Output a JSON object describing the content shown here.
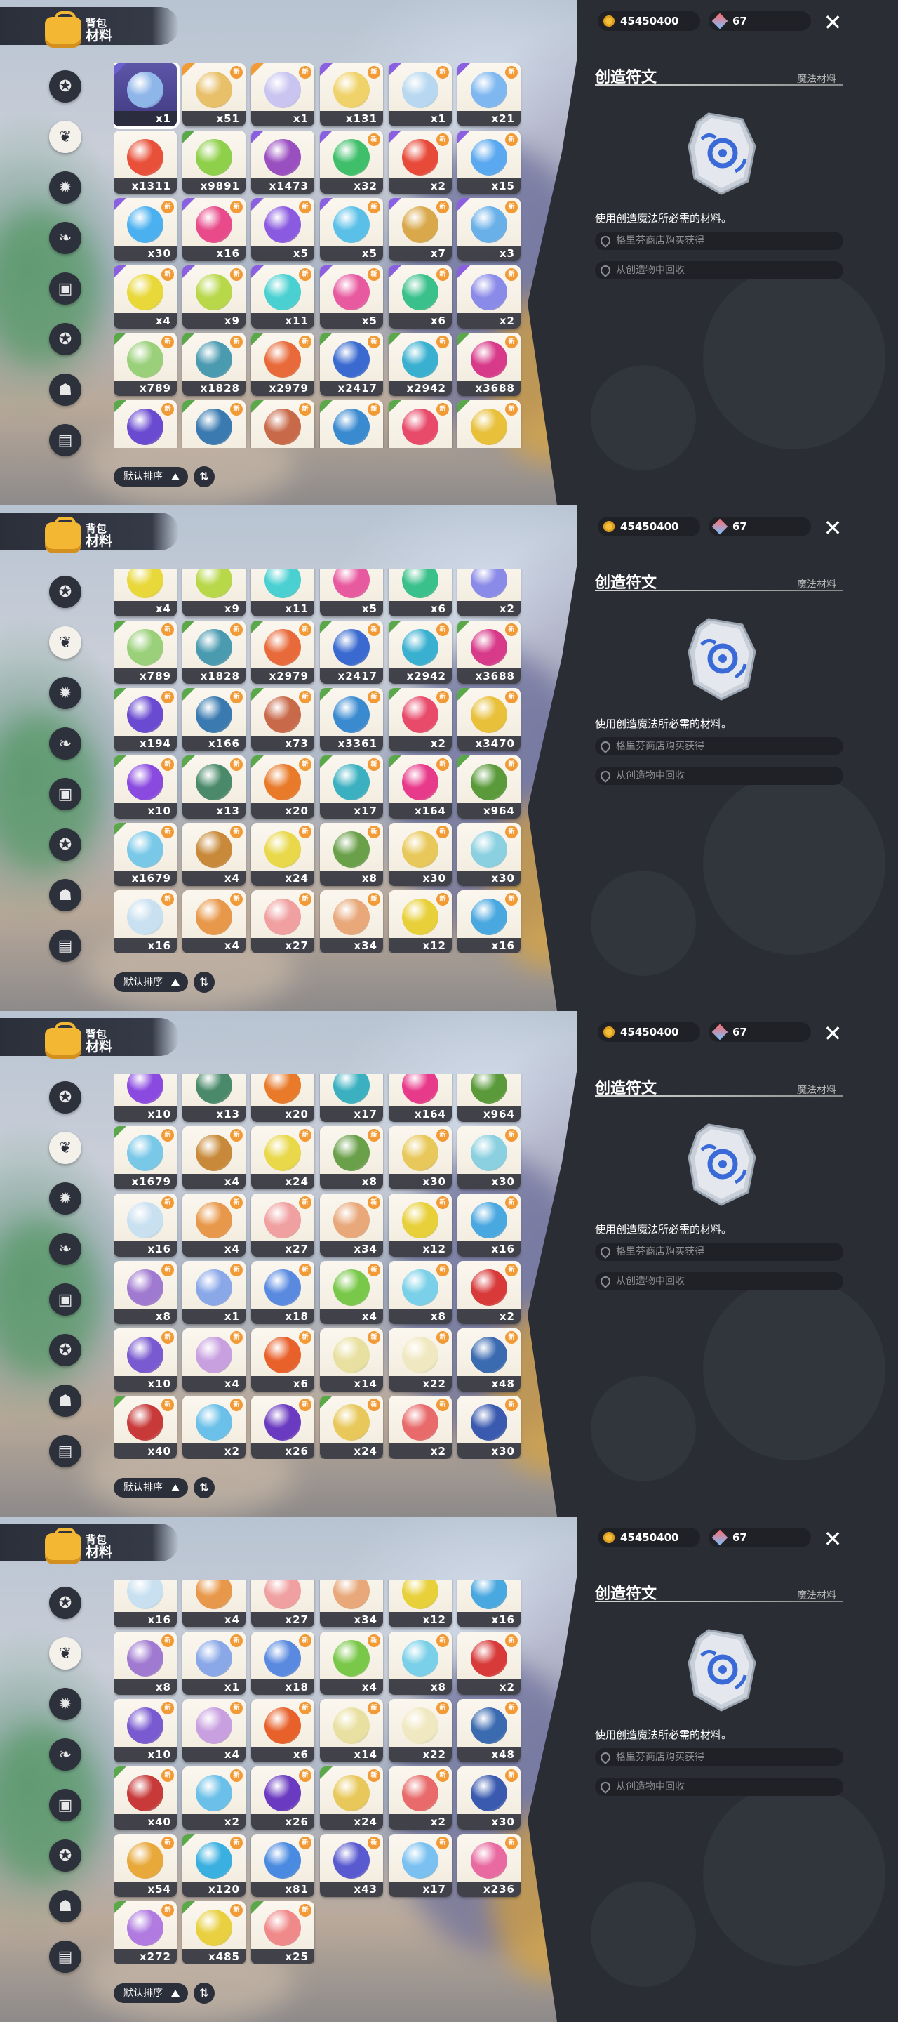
{
  "header": {
    "bag_label": "背包",
    "section_label": "材料"
  },
  "categories": [
    {
      "icon": "circle-star-icon"
    },
    {
      "icon": "leaf-sprout-icon"
    },
    {
      "icon": "star-badge-icon"
    },
    {
      "icon": "plant-icon"
    },
    {
      "icon": "chest-icon"
    },
    {
      "icon": "star-circle-icon"
    },
    {
      "icon": "bell-icon"
    },
    {
      "icon": "crate-icon"
    }
  ],
  "sort": {
    "label": "默认排序"
  },
  "currency": {
    "gold": "45450400",
    "gems": "67"
  },
  "detail": {
    "title": "创造符文",
    "category": "魔法材料",
    "description": "使用创造魔法所必需的材料。",
    "sources": [
      "格里芬商店购买获得",
      "从创造物中回收"
    ]
  },
  "panels": [
    {
      "rows": [
        [
          {
            "q": "x1",
            "c": "#8fb6e8",
            "sel": true,
            "tri": "#6c5fcf",
            "nb": false
          },
          {
            "q": "x51",
            "c": "#e8c06a",
            "tri": "#f29a35",
            "nb": true
          },
          {
            "q": "x1",
            "c": "#c9c4f0",
            "tri": "#f29a35",
            "nb": true
          },
          {
            "q": "x131",
            "c": "#f0d26a",
            "tri": "#8a5fe0",
            "nb": true
          },
          {
            "q": "x1",
            "c": "#b7d8f0",
            "tri": "#8a5fe0",
            "nb": true
          },
          {
            "q": "x21",
            "c": "#7fb8f0",
            "tri": "#8a5fe0",
            "nb": true
          }
        ],
        [
          {
            "q": "x1311",
            "c": "#e8503a",
            "tri": "",
            "nb": false
          },
          {
            "q": "x9891",
            "c": "#8fd04a",
            "tri": "#5aa84a",
            "nb": false
          },
          {
            "q": "x1473",
            "c": "#9a4fc0",
            "tri": "#8a5fe0",
            "nb": false
          },
          {
            "q": "x32",
            "c": "#3fbf6a",
            "tri": "#8a5fe0",
            "nb": true
          },
          {
            "q": "x2",
            "c": "#e84a3a",
            "tri": "#8a5fe0",
            "nb": true
          },
          {
            "q": "x15",
            "c": "#5aa8f0",
            "tri": "#8a5fe0",
            "nb": true
          }
        ],
        [
          {
            "q": "x30",
            "c": "#4ab0f0",
            "tri": "#8a5fe0",
            "nb": true
          },
          {
            "q": "x16",
            "c": "#e84a8a",
            "tri": "#8a5fe0",
            "nb": true
          },
          {
            "q": "x5",
            "c": "#8a5ae0",
            "tri": "#8a5fe0",
            "nb": true
          },
          {
            "q": "x5",
            "c": "#5ac0e8",
            "tri": "#8a5fe0",
            "nb": true
          },
          {
            "q": "x7",
            "c": "#d8a84a",
            "tri": "#8a5fe0",
            "nb": true
          },
          {
            "q": "x3",
            "c": "#6ab0e8",
            "tri": "#8a5fe0",
            "nb": true
          }
        ],
        [
          {
            "q": "x4",
            "c": "#e8d83a",
            "tri": "#8a5fe0",
            "nb": true
          },
          {
            "q": "x9",
            "c": "#b8d84a",
            "tri": "#8a5fe0",
            "nb": true
          },
          {
            "q": "x11",
            "c": "#4ad0d0",
            "tri": "#8a5fe0",
            "nb": true
          },
          {
            "q": "x5",
            "c": "#e85aa0",
            "tri": "#8a5fe0",
            "nb": true
          },
          {
            "q": "x6",
            "c": "#3ac08a",
            "tri": "#8a5fe0",
            "nb": true
          },
          {
            "q": "x2",
            "c": "#8a8ae8",
            "tri": "#8a5fe0",
            "nb": true
          }
        ],
        [
          {
            "q": "x789",
            "c": "#9ad07a",
            "tri": "#5aa84a",
            "nb": true
          },
          {
            "q": "x1828",
            "c": "#4a9ab0",
            "tri": "#5aa84a",
            "nb": true
          },
          {
            "q": "x2979",
            "c": "#e86a3a",
            "tri": "#5aa84a",
            "nb": true
          },
          {
            "q": "x2417",
            "c": "#3a6ad0",
            "tri": "#5aa84a",
            "nb": true
          },
          {
            "q": "x2942",
            "c": "#3ab0d0",
            "tri": "#5aa84a",
            "nb": true
          },
          {
            "q": "x3688",
            "c": "#d83a8a",
            "tri": "#5aa84a",
            "nb": true
          }
        ],
        [
          {
            "q": "x194",
            "c": "#6a4ad0",
            "tri": "#5aa84a",
            "nb": true
          },
          {
            "q": "x166",
            "c": "#3a7ab0",
            "tri": "#5aa84a",
            "nb": true
          },
          {
            "q": "x73",
            "c": "#c86a4a",
            "tri": "#5aa84a",
            "nb": true
          },
          {
            "q": "x3361",
            "c": "#3a8ad0",
            "tri": "#5aa84a",
            "nb": true
          },
          {
            "q": "x2",
            "c": "#e84a6a",
            "tri": "#5aa84a",
            "nb": true
          },
          {
            "q": "x3470",
            "c": "#e8c03a",
            "tri": "#5aa84a",
            "nb": true
          }
        ]
      ]
    },
    {
      "rows": [
        [
          {
            "q": "x4",
            "c": "#e8d83a",
            "tri": "#8a5fe0",
            "nb": true
          },
          {
            "q": "x9",
            "c": "#b8d84a",
            "tri": "#8a5fe0",
            "nb": true
          },
          {
            "q": "x11",
            "c": "#4ad0d0",
            "tri": "#8a5fe0",
            "nb": true
          },
          {
            "q": "x5",
            "c": "#e85aa0",
            "tri": "#8a5fe0",
            "nb": true
          },
          {
            "q": "x6",
            "c": "#3ac08a",
            "tri": "#8a5fe0",
            "nb": true
          },
          {
            "q": "x2",
            "c": "#8a8ae8",
            "tri": "#8a5fe0",
            "nb": true
          }
        ],
        [
          {
            "q": "x789",
            "c": "#9ad07a",
            "tri": "#5aa84a",
            "nb": true
          },
          {
            "q": "x1828",
            "c": "#4a9ab0",
            "tri": "#5aa84a",
            "nb": true
          },
          {
            "q": "x2979",
            "c": "#e86a3a",
            "tri": "#5aa84a",
            "nb": true
          },
          {
            "q": "x2417",
            "c": "#3a6ad0",
            "tri": "#5aa84a",
            "nb": true
          },
          {
            "q": "x2942",
            "c": "#3ab0d0",
            "tri": "#5aa84a",
            "nb": true
          },
          {
            "q": "x3688",
            "c": "#d83a8a",
            "tri": "#5aa84a",
            "nb": true
          }
        ],
        [
          {
            "q": "x194",
            "c": "#6a4ad0",
            "tri": "#5aa84a",
            "nb": true
          },
          {
            "q": "x166",
            "c": "#3a7ab0",
            "tri": "#5aa84a",
            "nb": true
          },
          {
            "q": "x73",
            "c": "#c86a4a",
            "tri": "#5aa84a",
            "nb": true
          },
          {
            "q": "x3361",
            "c": "#3a8ad0",
            "tri": "#5aa84a",
            "nb": true
          },
          {
            "q": "x2",
            "c": "#e84a6a",
            "tri": "#5aa84a",
            "nb": true
          },
          {
            "q": "x3470",
            "c": "#e8c03a",
            "tri": "#5aa84a",
            "nb": true
          }
        ],
        [
          {
            "q": "x10",
            "c": "#8a4ae0",
            "tri": "#5aa84a",
            "nb": true
          },
          {
            "q": "x13",
            "c": "#4a8a6a",
            "tri": "#5aa84a",
            "nb": true
          },
          {
            "q": "x20",
            "c": "#e87a2a",
            "tri": "#5aa84a",
            "nb": true
          },
          {
            "q": "x17",
            "c": "#3ab0c0",
            "tri": "#5aa84a",
            "nb": true
          },
          {
            "q": "x164",
            "c": "#e83a8a",
            "tri": "#5aa84a",
            "nb": true
          },
          {
            "q": "x964",
            "c": "#5a9a3a",
            "tri": "#5aa84a",
            "nb": true
          }
        ],
        [
          {
            "q": "x1679",
            "c": "#7ac8e8",
            "tri": "#5aa84a",
            "nb": true
          },
          {
            "q": "x4",
            "c": "#c88a3a",
            "tri": "",
            "nb": true
          },
          {
            "q": "x24",
            "c": "#e8d84a",
            "tri": "",
            "nb": true
          },
          {
            "q": "x8",
            "c": "#6aa04a",
            "tri": "",
            "nb": true
          },
          {
            "q": "x30",
            "c": "#e8c85a",
            "tri": "",
            "nb": true
          },
          {
            "q": "x30",
            "c": "#8ad0e0",
            "tri": "",
            "nb": true
          }
        ],
        [
          {
            "q": "x16",
            "c": "#c8e0f0",
            "tri": "",
            "nb": true
          },
          {
            "q": "x4",
            "c": "#e8984a",
            "tri": "",
            "nb": true
          },
          {
            "q": "x27",
            "c": "#f0a0a0",
            "tri": "",
            "nb": true
          },
          {
            "q": "x34",
            "c": "#e8a87a",
            "tri": "",
            "nb": true
          },
          {
            "q": "x12",
            "c": "#e8d03a",
            "tri": "",
            "nb": true
          },
          {
            "q": "x16",
            "c": "#4aa8e0",
            "tri": "",
            "nb": true
          }
        ]
      ]
    },
    {
      "rows": [
        [
          {
            "q": "x10",
            "c": "#8a4ae0",
            "tri": "#5aa84a",
            "nb": true
          },
          {
            "q": "x13",
            "c": "#4a8a6a",
            "tri": "#5aa84a",
            "nb": true
          },
          {
            "q": "x20",
            "c": "#e87a2a",
            "tri": "#5aa84a",
            "nb": true
          },
          {
            "q": "x17",
            "c": "#3ab0c0",
            "tri": "#5aa84a",
            "nb": true
          },
          {
            "q": "x164",
            "c": "#e83a8a",
            "tri": "#5aa84a",
            "nb": true
          },
          {
            "q": "x964",
            "c": "#5a9a3a",
            "tri": "#5aa84a",
            "nb": true
          }
        ],
        [
          {
            "q": "x1679",
            "c": "#7ac8e8",
            "tri": "#5aa84a",
            "nb": true
          },
          {
            "q": "x4",
            "c": "#c88a3a",
            "tri": "",
            "nb": true
          },
          {
            "q": "x24",
            "c": "#e8d84a",
            "tri": "",
            "nb": true
          },
          {
            "q": "x8",
            "c": "#6aa04a",
            "tri": "",
            "nb": true
          },
          {
            "q": "x30",
            "c": "#e8c85a",
            "tri": "",
            "nb": true
          },
          {
            "q": "x30",
            "c": "#8ad0e0",
            "tri": "",
            "nb": true
          }
        ],
        [
          {
            "q": "x16",
            "c": "#c8e0f0",
            "tri": "",
            "nb": true
          },
          {
            "q": "x4",
            "c": "#e8984a",
            "tri": "",
            "nb": true
          },
          {
            "q": "x27",
            "c": "#f0a0a0",
            "tri": "",
            "nb": true
          },
          {
            "q": "x34",
            "c": "#e8a87a",
            "tri": "",
            "nb": true
          },
          {
            "q": "x12",
            "c": "#e8d03a",
            "tri": "",
            "nb": true
          },
          {
            "q": "x16",
            "c": "#4aa8e0",
            "tri": "",
            "nb": true
          }
        ],
        [
          {
            "q": "x8",
            "c": "#a07ad0",
            "tri": "",
            "nb": true
          },
          {
            "q": "x1",
            "c": "#8aa8e8",
            "tri": "",
            "nb": true
          },
          {
            "q": "x18",
            "c": "#5a8ae0",
            "tri": "",
            "nb": true
          },
          {
            "q": "x4",
            "c": "#7ac84a",
            "tri": "",
            "nb": true
          },
          {
            "q": "x8",
            "c": "#7ad0e8",
            "tri": "",
            "nb": true
          },
          {
            "q": "x2",
            "c": "#d83a3a",
            "tri": "",
            "nb": true
          }
        ],
        [
          {
            "q": "x10",
            "c": "#7a5ad0",
            "tri": "",
            "nb": true
          },
          {
            "q": "x4",
            "c": "#c8a0e0",
            "tri": "",
            "nb": true
          },
          {
            "q": "x6",
            "c": "#e8602a",
            "tri": "",
            "nb": true
          },
          {
            "q": "x14",
            "c": "#e8e0a0",
            "tri": "",
            "nb": true
          },
          {
            "q": "x22",
            "c": "#f0e8c0",
            "tri": "",
            "nb": true
          },
          {
            "q": "x48",
            "c": "#3a6ab0",
            "tri": "",
            "nb": true
          }
        ],
        [
          {
            "q": "x40",
            "c": "#c83a3a",
            "tri": "#5aa84a",
            "nb": true
          },
          {
            "q": "x2",
            "c": "#6ac0e8",
            "tri": "",
            "nb": true
          },
          {
            "q": "x26",
            "c": "#6a3ac0",
            "tri": "",
            "nb": true
          },
          {
            "q": "x24",
            "c": "#e8c85a",
            "tri": "#5aa84a",
            "nb": true
          },
          {
            "q": "x2",
            "c": "#e86a6a",
            "tri": "",
            "nb": true
          },
          {
            "q": "x30",
            "c": "#3a5ab0",
            "tri": "",
            "nb": true
          }
        ]
      ]
    },
    {
      "rows": [
        [
          {
            "q": "x16",
            "c": "#c8e0f0",
            "tri": "",
            "nb": true
          },
          {
            "q": "x4",
            "c": "#e8984a",
            "tri": "",
            "nb": true
          },
          {
            "q": "x27",
            "c": "#f0a0a0",
            "tri": "",
            "nb": true
          },
          {
            "q": "x34",
            "c": "#e8a87a",
            "tri": "",
            "nb": true
          },
          {
            "q": "x12",
            "c": "#e8d03a",
            "tri": "",
            "nb": true
          },
          {
            "q": "x16",
            "c": "#4aa8e0",
            "tri": "",
            "nb": true
          }
        ],
        [
          {
            "q": "x8",
            "c": "#a07ad0",
            "tri": "",
            "nb": true
          },
          {
            "q": "x1",
            "c": "#8aa8e8",
            "tri": "",
            "nb": true
          },
          {
            "q": "x18",
            "c": "#5a8ae0",
            "tri": "",
            "nb": true
          },
          {
            "q": "x4",
            "c": "#7ac84a",
            "tri": "",
            "nb": true
          },
          {
            "q": "x8",
            "c": "#7ad0e8",
            "tri": "",
            "nb": true
          },
          {
            "q": "x2",
            "c": "#d83a3a",
            "tri": "",
            "nb": true
          }
        ],
        [
          {
            "q": "x10",
            "c": "#7a5ad0",
            "tri": "",
            "nb": true
          },
          {
            "q": "x4",
            "c": "#c8a0e0",
            "tri": "",
            "nb": true
          },
          {
            "q": "x6",
            "c": "#e8602a",
            "tri": "",
            "nb": true
          },
          {
            "q": "x14",
            "c": "#e8e0a0",
            "tri": "",
            "nb": true
          },
          {
            "q": "x22",
            "c": "#f0e8c0",
            "tri": "",
            "nb": true
          },
          {
            "q": "x48",
            "c": "#3a6ab0",
            "tri": "",
            "nb": true
          }
        ],
        [
          {
            "q": "x40",
            "c": "#c83a3a",
            "tri": "#5aa84a",
            "nb": true
          },
          {
            "q": "x2",
            "c": "#6ac0e8",
            "tri": "",
            "nb": true
          },
          {
            "q": "x26",
            "c": "#6a3ac0",
            "tri": "",
            "nb": true
          },
          {
            "q": "x24",
            "c": "#e8c85a",
            "tri": "#5aa84a",
            "nb": true
          },
          {
            "q": "x2",
            "c": "#e86a6a",
            "tri": "",
            "nb": true
          },
          {
            "q": "x30",
            "c": "#3a5ab0",
            "tri": "",
            "nb": true
          }
        ],
        [
          {
            "q": "x54",
            "c": "#e8a83a",
            "tri": "",
            "nb": true
          },
          {
            "q": "x120",
            "c": "#3ab0e0",
            "tri": "#5aa84a",
            "nb": true
          },
          {
            "q": "x81",
            "c": "#4a8ae0",
            "tri": "",
            "nb": true
          },
          {
            "q": "x43",
            "c": "#5a5ad0",
            "tri": "",
            "nb": true
          },
          {
            "q": "x17",
            "c": "#7ac0f0",
            "tri": "",
            "nb": true
          },
          {
            "q": "x236",
            "c": "#e86aa0",
            "tri": "",
            "nb": true
          }
        ],
        [
          {
            "q": "x272",
            "c": "#b07ae0",
            "tri": "#5aa84a",
            "nb": true
          },
          {
            "q": "x485",
            "c": "#e8d040",
            "tri": "#5aa84a",
            "nb": true
          },
          {
            "q": "x25",
            "c": "#f08a8a",
            "tri": "#5aa84a",
            "nb": true
          }
        ]
      ]
    }
  ],
  "panel_row_offsets": [
    0,
    0,
    0,
    0
  ]
}
